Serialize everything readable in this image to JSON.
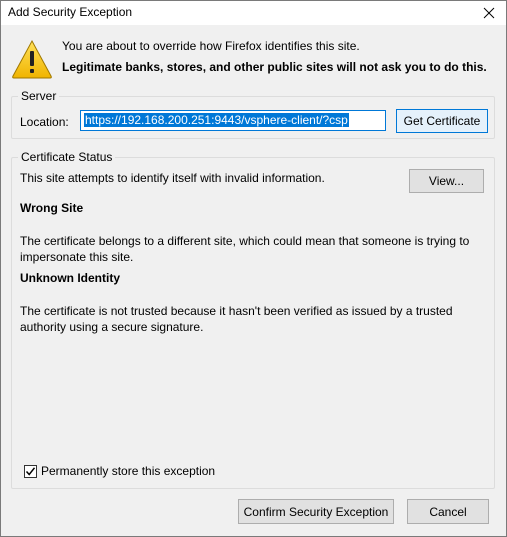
{
  "window": {
    "title": "Add Security Exception"
  },
  "header": {
    "message": "You are about to override how Firefox identifies this site.",
    "warning": "Legitimate banks, stores, and other public sites will not ask you to do this."
  },
  "server": {
    "legend": "Server",
    "location_label": "Location:",
    "location_value": "https://192.168.200.251:9443/vsphere-client/?csp",
    "get_certificate_label": "Get Certificate"
  },
  "status": {
    "legend": "Certificate Status",
    "intro": "This site attempts to identify itself with invalid information.",
    "view_label": "View...",
    "wrong_site_title": "Wrong Site",
    "wrong_site_text": "The certificate belongs to a different site, which could mean that someone is trying to impersonate this site.",
    "unknown_identity_title": "Unknown Identity",
    "unknown_identity_text": "The certificate is not trusted because it hasn't been verified as issued by a trusted authority using a secure signature.",
    "permanent_label": "Permanently store this exception",
    "permanent_checked": true
  },
  "footer": {
    "confirm_label": "Confirm Security Exception",
    "cancel_label": "Cancel"
  },
  "icons": {
    "warning": "warning-triangle-icon",
    "close": "close-icon",
    "check": "checkmark-icon"
  },
  "colors": {
    "selection": "#0078d7",
    "warning_yellow": "#f5c400"
  }
}
